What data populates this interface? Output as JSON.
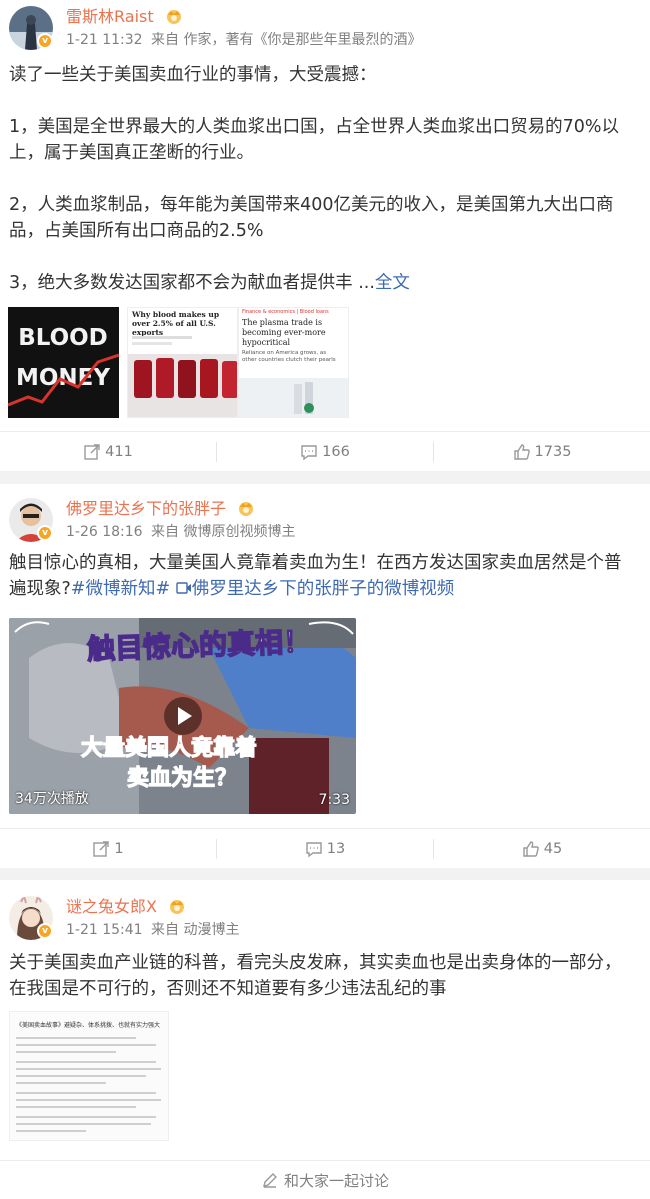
{
  "posts": [
    {
      "user": {
        "name": "雷斯林Raist",
        "verified_badge": "v"
      },
      "meta": {
        "time": "1-21 11:32",
        "source": "来自 作家，著有《你是那些年里最烈的酒》"
      },
      "text": {
        "line1": "读了一些关于美国卖血行业的事情，大受震撼：",
        "line2": "1，美国是全世界最大的人类血浆出口国，占全世界人类血浆出口贸易的70%以上，属于美国真正垄断的行业。",
        "line3": "2，人类血浆制品，每年能为美国带来400亿美元的收入，是美国第九大出口商品，占美国所有出口商品的2.5%",
        "line4": "3，绝大多数发达国家都不会为献血者提供丰 ...",
        "full_link": "全文"
      },
      "images": [
        {
          "icon": "blood-money-poster",
          "lines": [
            "BLOOD",
            "MONEY"
          ]
        },
        {
          "icon": "article-thumbnail",
          "headline": "Why blood makes up over 2.5% of all U.S. exports"
        },
        {
          "icon": "article-thumbnail",
          "kicker": "Finance & economics | Blood loans",
          "headline": "The plasma trade is becoming ever-more hypocritical",
          "sub": "Reliance on America grows, as other countries clutch their pearls"
        }
      ],
      "actions": {
        "share": "411",
        "comment": "166",
        "like": "1735"
      }
    },
    {
      "user": {
        "name": "佛罗里达乡下的张胖子",
        "verified_badge": "v"
      },
      "meta": {
        "time": "1-26 18:16",
        "source": "来自 微博原创视频博主"
      },
      "text": {
        "body": "触目惊心的真相，大量美国人竟靠着卖血为生！在西方发达国家卖血居然是个普遍现象?",
        "hashtag": "#微博新知#",
        "video_link": "佛罗里达乡下的张胖子的微博视频"
      },
      "video": {
        "caption_top": "触目惊心的真相！",
        "caption_mid": "大量美国人竟靠着",
        "caption_bottom": "卖血为生？",
        "plays": "34万次播放",
        "duration": "7:33"
      },
      "actions": {
        "share": "1",
        "comment": "13",
        "like": "45"
      }
    },
    {
      "user": {
        "name": "谜之兔女郎X",
        "verified_badge": "v"
      },
      "meta": {
        "time": "1-21 15:41",
        "source": "来自 动漫博主"
      },
      "text": {
        "body": "关于美国卖血产业链的科普，看完头皮发麻，其实卖血也是出卖身体的一部分，在我国是不可行的，否则还不知道要有多少违法乱纪的事"
      },
      "doc_title": "《美国卖血故事》避疑杂、体系挑拨、也就有实力强大",
      "discuss": "和大家一起讨论"
    }
  ],
  "colors": {
    "username": "#eb7350",
    "link": "#3e6ab0",
    "meta": "#808080",
    "background": "#f2f2f2"
  }
}
